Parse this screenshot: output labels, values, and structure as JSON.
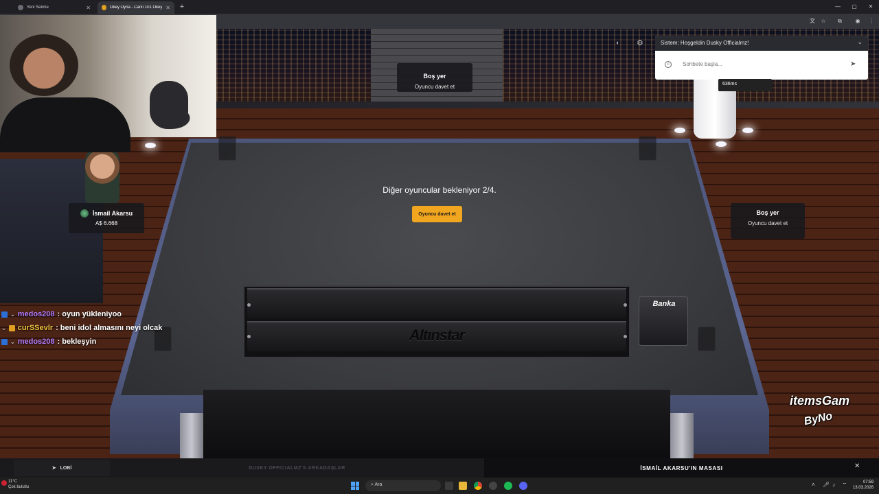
{
  "browser": {
    "tabs": [
      {
        "label": "Yeni Sekme",
        "active": false
      },
      {
        "label": "Okey Oyna - Canlı 101 Okey ve...",
        "active": true
      }
    ]
  },
  "webcam": {
    "label": "streamer-webcam"
  },
  "chat": {
    "system_message": "Sistem: Hoşgeldin Dusky Officialmz!",
    "input_placeholder": "Sohbete başla...",
    "ping": "636ms"
  },
  "seats": {
    "top": {
      "title": "Boş yer",
      "subtitle": "Oyuncu davet et"
    },
    "right": {
      "title": "Boş yer",
      "subtitle": "Oyuncu davet et"
    },
    "left": {
      "player_name": "İsmail Akarsu",
      "money": "A$ 6.668"
    }
  },
  "table": {
    "waiting_text": "Diğer oyuncular bekleniyor 2/4.",
    "invite_button": "Oyuncu davet et",
    "rack_brand": "Altınstar",
    "bank_label": "Banka"
  },
  "twitch_chat": [
    {
      "user": "medos208",
      "message": ": oyun yükleniyoo",
      "color": "#b57cff"
    },
    {
      "user": "curSSevlr",
      "message": ": beni idol almasını neyi olcak",
      "color": "#f0c040"
    },
    {
      "user": "medos208",
      "message": ": bekleşyin",
      "color": "#b57cff"
    }
  ],
  "bottom_bar": {
    "lobby_label": "LOBİ",
    "friends_label": "DUSKY OFFICIALMZ'S ARKADAŞLAR",
    "table_label": "İSMAİL AKARSU'IN MASASI"
  },
  "taskbar": {
    "temperature": "11°C",
    "weather": "Çok bulutlu",
    "search_placeholder": "Ara",
    "time": "07:59",
    "date": "13.03.2026"
  },
  "watermark": {
    "line1": "itemsGam",
    "line2": "ByNo"
  },
  "colors": {
    "accent": "#f0a61f",
    "rim": "#5c6794"
  }
}
